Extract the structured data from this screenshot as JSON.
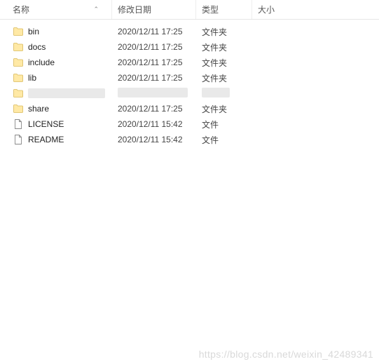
{
  "header": {
    "name": "名称",
    "date": "修改日期",
    "type": "类型",
    "size": "大小"
  },
  "rows": [
    {
      "icon": "folder",
      "name": "bin",
      "date": "2020/12/11 17:25",
      "type": "文件夹",
      "redacted": false
    },
    {
      "icon": "folder",
      "name": "docs",
      "date": "2020/12/11 17:25",
      "type": "文件夹",
      "redacted": false
    },
    {
      "icon": "folder",
      "name": "include",
      "date": "2020/12/11 17:25",
      "type": "文件夹",
      "redacted": false
    },
    {
      "icon": "folder",
      "name": "lib",
      "date": "2020/12/11 17:25",
      "type": "文件夹",
      "redacted": false
    },
    {
      "icon": "folder",
      "name": "",
      "date": "",
      "type": "",
      "redacted": true
    },
    {
      "icon": "folder",
      "name": "share",
      "date": "2020/12/11 17:25",
      "type": "文件夹",
      "redacted": false
    },
    {
      "icon": "file",
      "name": "LICENSE",
      "date": "2020/12/11 15:42",
      "type": "文件",
      "redacted": false
    },
    {
      "icon": "file",
      "name": "README",
      "date": "2020/12/11 15:42",
      "type": "文件",
      "redacted": false
    }
  ],
  "watermark": "https://blog.csdn.net/weixin_42489341"
}
